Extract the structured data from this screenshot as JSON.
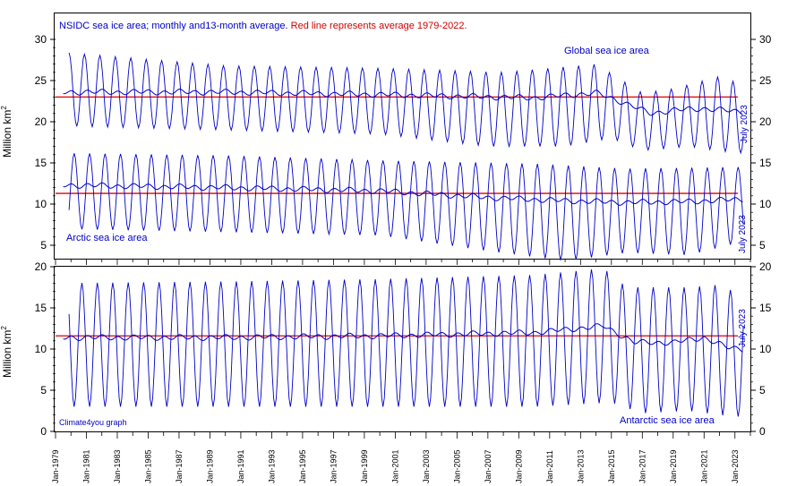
{
  "title_part1": "NSIDC sea ice area; monthly and13-month average. ",
  "title_part2": "Red line represents average 1979-2022.",
  "credit": "Climate4you graph",
  "colors": {
    "series": "#0000c8",
    "average": "#e00000",
    "axis": "#000000"
  },
  "chart_data": [
    {
      "type": "line",
      "panel": "upper",
      "ylabel_base": "Million km",
      "ylabel_sup": "2",
      "ylim": [
        5,
        30
      ],
      "yticks": [
        "5",
        "10",
        "15",
        "20",
        "25",
        "30"
      ],
      "xlim": [
        1979.0,
        2024.0
      ],
      "xtick_labels": [
        "Jan-1979",
        "Jan-1981",
        "Jan-1983",
        "Jan-1985",
        "Jan-1987",
        "Jan-1989",
        "Jan-1991",
        "Jan-1993",
        "Jan-1995",
        "Jan-1997",
        "Jan-1999",
        "Jan-2001",
        "Jan-2003",
        "Jan-2005",
        "Jan-2007",
        "Jan-2009",
        "Jan-2011",
        "Jan-2013",
        "Jan-2015",
        "Jan-2017",
        "Jan-2019",
        "Jan-2021",
        "Jan-2023"
      ],
      "series": [
        {
          "name": "Global sea ice area",
          "end_label": "July 2023",
          "average_1979_2022": 23.0,
          "trend_points": [
            [
              1979.5,
              23.6
            ],
            [
              1990,
              23.6
            ],
            [
              2000,
              23.3
            ],
            [
              2010,
              22.9
            ],
            [
              2014,
              23.5
            ],
            [
              2016,
              22.2
            ],
            [
              2017.5,
              21.0
            ],
            [
              2019,
              21.4
            ],
            [
              2021,
              21.6
            ],
            [
              2023.5,
              21.2
            ]
          ],
          "seasonal_max": [
            [
              1979,
              28.5
            ],
            [
              1990,
              26.8
            ],
            [
              2000,
              26.5
            ],
            [
              2008,
              26.0
            ],
            [
              2014,
              27.0
            ],
            [
              2017,
              23.5
            ],
            [
              2019,
              24.0
            ],
            [
              2022,
              25.5
            ],
            [
              2023.5,
              24.5
            ]
          ],
          "seasonal_min": [
            [
              1979,
              19.5
            ],
            [
              1990,
              19.0
            ],
            [
              2000,
              18.5
            ],
            [
              2007,
              17.0
            ],
            [
              2012,
              17.0
            ],
            [
              2015,
              18.0
            ],
            [
              2017,
              16.5
            ],
            [
              2020,
              17.0
            ],
            [
              2023,
              16.2
            ]
          ]
        },
        {
          "name": "Arctic sea ice area",
          "end_label": "July 2023",
          "average_1979_2022": 11.3,
          "trend_points": [
            [
              1979.5,
              12.3
            ],
            [
              1990,
              12.0
            ],
            [
              2000,
              11.6
            ],
            [
              2007,
              10.8
            ],
            [
              2012,
              10.4
            ],
            [
              2016,
              10.2
            ],
            [
              2020,
              10.3
            ],
            [
              2023.5,
              10.6
            ]
          ],
          "seasonal_max": [
            [
              1979,
              16.2
            ],
            [
              1990,
              15.9
            ],
            [
              2000,
              15.3
            ],
            [
              2010,
              14.9
            ],
            [
              2016,
              14.3
            ],
            [
              2023.5,
              14.5
            ]
          ],
          "seasonal_min": [
            [
              1979,
              7.0
            ],
            [
              1990,
              6.6
            ],
            [
              2000,
              6.2
            ],
            [
              2007,
              4.3
            ],
            [
              2012,
              3.1
            ],
            [
              2016,
              4.1
            ],
            [
              2020,
              3.8
            ],
            [
              2023,
              5.2
            ]
          ]
        }
      ]
    },
    {
      "type": "line",
      "panel": "lower",
      "ylabel_base": "Million km",
      "ylabel_sup": "2",
      "ylim": [
        0,
        20
      ],
      "yticks": [
        "0",
        "5",
        "10",
        "15",
        "20"
      ],
      "xlim": [
        1979.0,
        2024.0
      ],
      "series": [
        {
          "name": "Antarctic sea ice area",
          "end_label": "July 2023",
          "average_1979_2022": 11.6,
          "trend_points": [
            [
              1979.5,
              11.4
            ],
            [
              1990,
              11.4
            ],
            [
              2000,
              11.6
            ],
            [
              2010,
              12.0
            ],
            [
              2014.5,
              12.8
            ],
            [
              2016.5,
              10.8
            ],
            [
              2019,
              10.8
            ],
            [
              2021,
              11.4
            ],
            [
              2022.5,
              10.2
            ],
            [
              2023.5,
              10.0
            ]
          ],
          "seasonal_max": [
            [
              1979,
              18.0
            ],
            [
              1990,
              18.2
            ],
            [
              2000,
              18.5
            ],
            [
              2010,
              19.0
            ],
            [
              2014.5,
              19.8
            ],
            [
              2016,
              17.5
            ],
            [
              2020,
              17.5
            ],
            [
              2022,
              17.8
            ],
            [
              2023.5,
              16.5
            ]
          ],
          "seasonal_min": [
            [
              1979,
              3.0
            ],
            [
              1990,
              3.0
            ],
            [
              2000,
              3.0
            ],
            [
              2010,
              3.0
            ],
            [
              2015,
              3.5
            ],
            [
              2017,
              2.2
            ],
            [
              2020,
              2.5
            ],
            [
              2022,
              2.0
            ],
            [
              2023,
              1.8
            ]
          ]
        }
      ]
    }
  ]
}
